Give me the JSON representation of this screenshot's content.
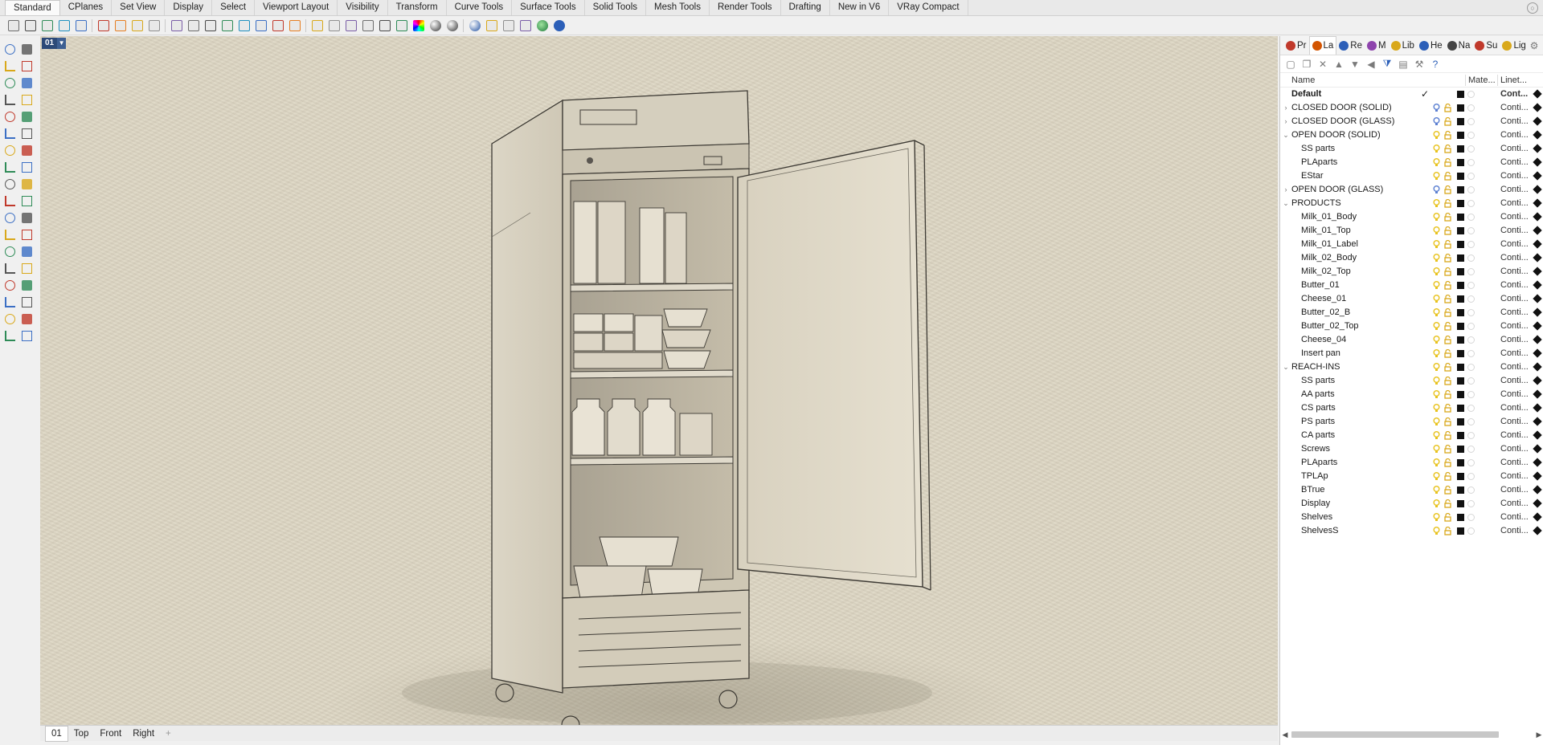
{
  "ribbon": {
    "tabs": [
      "Standard",
      "CPlanes",
      "Set View",
      "Display",
      "Select",
      "Viewport Layout",
      "Visibility",
      "Transform",
      "Curve Tools",
      "Surface Tools",
      "Solid Tools",
      "Mesh Tools",
      "Render Tools",
      "Drafting",
      "New in V6",
      "VRay Compact"
    ],
    "active_tab": "Standard"
  },
  "viewport": {
    "title": "01",
    "tabs": [
      "01",
      "Top",
      "Front",
      "Right"
    ],
    "active_tab": "01",
    "background_color": "#ddd6c3"
  },
  "panel": {
    "tabs": [
      {
        "label": "Pr",
        "icon": "properties-icon"
      },
      {
        "label": "La",
        "icon": "layers-icon"
      },
      {
        "label": "Re",
        "icon": "rendering-icon"
      },
      {
        "label": "M",
        "icon": "materials-icon"
      },
      {
        "label": "Lib",
        "icon": "libraries-icon"
      },
      {
        "label": "He",
        "icon": "help-icon"
      },
      {
        "label": "Na",
        "icon": "named-views-icon"
      },
      {
        "label": "Su",
        "icon": "sun-icon"
      },
      {
        "label": "Lig",
        "icon": "lights-icon"
      }
    ],
    "active_tab": "La",
    "columns": {
      "name": "Name",
      "material": "Mate...",
      "linetype": "Linet..."
    },
    "layers": [
      {
        "name": "Default",
        "level": 0,
        "expander": "",
        "bold": true,
        "current": true,
        "linetype": "Cont...",
        "bulb": "none"
      },
      {
        "name": "CLOSED DOOR (SOLID)",
        "level": 0,
        "expander": "›",
        "bold": false,
        "current": false,
        "linetype": "Conti...",
        "bulb": "off"
      },
      {
        "name": "CLOSED DOOR (GLASS)",
        "level": 0,
        "expander": "›",
        "bold": false,
        "current": false,
        "linetype": "Conti...",
        "bulb": "off"
      },
      {
        "name": "OPEN DOOR (SOLID)",
        "level": 0,
        "expander": "⌄",
        "bold": false,
        "current": false,
        "linetype": "Conti...",
        "bulb": "on"
      },
      {
        "name": "SS parts",
        "level": 1,
        "expander": "",
        "bold": false,
        "current": false,
        "linetype": "Conti...",
        "bulb": "on"
      },
      {
        "name": "PLAparts",
        "level": 1,
        "expander": "",
        "bold": false,
        "current": false,
        "linetype": "Conti...",
        "bulb": "on"
      },
      {
        "name": "EStar",
        "level": 1,
        "expander": "",
        "bold": false,
        "current": false,
        "linetype": "Conti...",
        "bulb": "on"
      },
      {
        "name": "OPEN DOOR (GLASS)",
        "level": 0,
        "expander": "›",
        "bold": false,
        "current": false,
        "linetype": "Conti...",
        "bulb": "off"
      },
      {
        "name": "PRODUCTS",
        "level": 0,
        "expander": "⌄",
        "bold": false,
        "current": false,
        "linetype": "Conti...",
        "bulb": "on"
      },
      {
        "name": "Milk_01_Body",
        "level": 1,
        "expander": "",
        "bold": false,
        "current": false,
        "linetype": "Conti...",
        "bulb": "on"
      },
      {
        "name": "Milk_01_Top",
        "level": 1,
        "expander": "",
        "bold": false,
        "current": false,
        "linetype": "Conti...",
        "bulb": "on"
      },
      {
        "name": "Milk_01_Label",
        "level": 1,
        "expander": "",
        "bold": false,
        "current": false,
        "linetype": "Conti...",
        "bulb": "on"
      },
      {
        "name": "Milk_02_Body",
        "level": 1,
        "expander": "",
        "bold": false,
        "current": false,
        "linetype": "Conti...",
        "bulb": "on"
      },
      {
        "name": "Milk_02_Top",
        "level": 1,
        "expander": "",
        "bold": false,
        "current": false,
        "linetype": "Conti...",
        "bulb": "on"
      },
      {
        "name": "Butter_01",
        "level": 1,
        "expander": "",
        "bold": false,
        "current": false,
        "linetype": "Conti...",
        "bulb": "on"
      },
      {
        "name": "Cheese_01",
        "level": 1,
        "expander": "",
        "bold": false,
        "current": false,
        "linetype": "Conti...",
        "bulb": "on"
      },
      {
        "name": "Butter_02_B",
        "level": 1,
        "expander": "",
        "bold": false,
        "current": false,
        "linetype": "Conti...",
        "bulb": "on"
      },
      {
        "name": "Butter_02_Top",
        "level": 1,
        "expander": "",
        "bold": false,
        "current": false,
        "linetype": "Conti...",
        "bulb": "on"
      },
      {
        "name": "Cheese_04",
        "level": 1,
        "expander": "",
        "bold": false,
        "current": false,
        "linetype": "Conti...",
        "bulb": "on"
      },
      {
        "name": "Insert pan",
        "level": 1,
        "expander": "",
        "bold": false,
        "current": false,
        "linetype": "Conti...",
        "bulb": "on"
      },
      {
        "name": "REACH-INS",
        "level": 0,
        "expander": "⌄",
        "bold": false,
        "current": false,
        "linetype": "Conti...",
        "bulb": "on"
      },
      {
        "name": "SS parts",
        "level": 1,
        "expander": "",
        "bold": false,
        "current": false,
        "linetype": "Conti...",
        "bulb": "on"
      },
      {
        "name": "AA parts",
        "level": 1,
        "expander": "",
        "bold": false,
        "current": false,
        "linetype": "Conti...",
        "bulb": "on"
      },
      {
        "name": "CS parts",
        "level": 1,
        "expander": "",
        "bold": false,
        "current": false,
        "linetype": "Conti...",
        "bulb": "on"
      },
      {
        "name": "PS parts",
        "level": 1,
        "expander": "",
        "bold": false,
        "current": false,
        "linetype": "Conti...",
        "bulb": "on"
      },
      {
        "name": "CA parts",
        "level": 1,
        "expander": "",
        "bold": false,
        "current": false,
        "linetype": "Conti...",
        "bulb": "on"
      },
      {
        "name": "Screws",
        "level": 1,
        "expander": "",
        "bold": false,
        "current": false,
        "linetype": "Conti...",
        "bulb": "on"
      },
      {
        "name": "PLAparts",
        "level": 1,
        "expander": "",
        "bold": false,
        "current": false,
        "linetype": "Conti...",
        "bulb": "on"
      },
      {
        "name": "TPLAp",
        "level": 1,
        "expander": "",
        "bold": false,
        "current": false,
        "linetype": "Conti...",
        "bulb": "on"
      },
      {
        "name": "BTrue",
        "level": 1,
        "expander": "",
        "bold": false,
        "current": false,
        "linetype": "Conti...",
        "bulb": "on"
      },
      {
        "name": "Display",
        "level": 1,
        "expander": "",
        "bold": false,
        "current": false,
        "linetype": "Conti...",
        "bulb": "on"
      },
      {
        "name": "Shelves",
        "level": 1,
        "expander": "",
        "bold": false,
        "current": false,
        "linetype": "Conti...",
        "bulb": "on"
      },
      {
        "name": "ShelvesS",
        "level": 1,
        "expander": "",
        "bold": false,
        "current": false,
        "linetype": "Conti...",
        "bulb": "on"
      }
    ],
    "colors": {
      "bulb_on": "#e8c21c",
      "bulb_off": "#5b7fd1",
      "lock": "#d9a81a",
      "layer_color": "#111111"
    }
  },
  "toolbar_icons": [
    "new-icon",
    "open-icon",
    "save-icon",
    "print-icon",
    "import-icon",
    "cut-icon",
    "copy-icon",
    "paste-icon",
    "undo-icon",
    "pan-icon",
    "move-view-icon",
    "zoom-icon",
    "zoom-window-icon",
    "zoom-extents-icon",
    "zoom-selected-icon",
    "rotate-view-icon",
    "four-viewports-icon",
    "car-icon",
    "hide-icon",
    "show-icon",
    "lock-icon",
    "unlock-icon",
    "layer-icon",
    "color-icon",
    "shade-icon",
    "rendered-icon",
    "render-icon",
    "lights-icon",
    "gear-icon",
    "grid-icon",
    "globe-icon",
    "help-icon"
  ],
  "left_tool_icons": [
    "select-icon",
    "point-icon",
    "polyline-icon",
    "rectangle-icon",
    "circle-icon",
    "ellipse-icon",
    "arc-icon",
    "polygon-icon",
    "curve-icon",
    "fillet-icon",
    "surface-icon",
    "loft-icon",
    "box-icon",
    "sphere-icon",
    "extrude-icon",
    "cylinder-icon",
    "boolean-icon",
    "burn-icon",
    "split-icon",
    "trim-icon",
    "explode-icon",
    "join-icon",
    "rebuild-icon",
    "blend-icon",
    "text-icon",
    "dimension-icon",
    "array-icon",
    "transform-icon",
    "grid-array-icon",
    "scale-icon",
    "block-icon",
    "ruler-icon",
    "section-icon",
    "check-icon",
    "analyze-icon",
    "warning-icon"
  ]
}
